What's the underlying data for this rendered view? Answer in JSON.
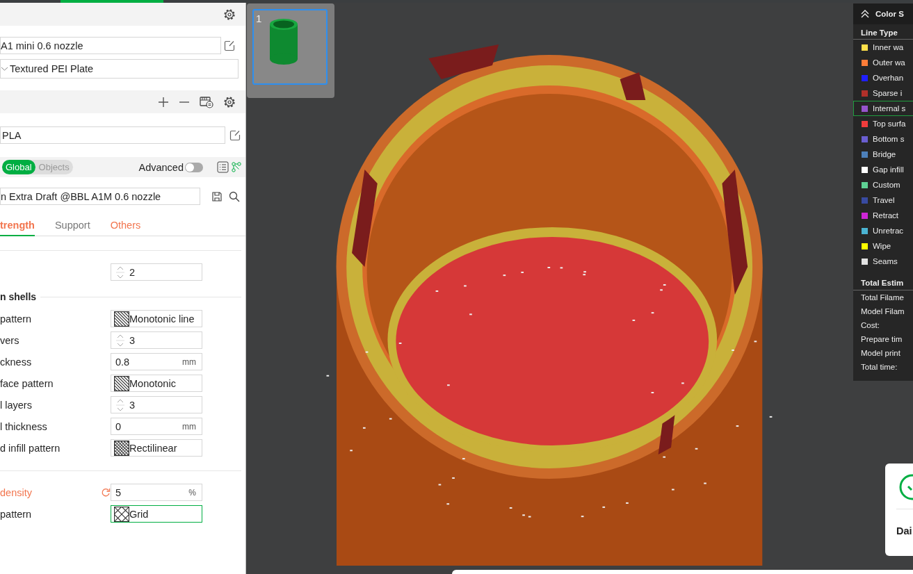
{
  "printer": {
    "preset": "A1 mini 0.6 nozzle",
    "plate": "Textured PEI Plate"
  },
  "filament": {
    "preset": "PLA"
  },
  "scope": {
    "segments": [
      {
        "label": "Global",
        "selected": true
      },
      {
        "label": "Objects",
        "selected": false
      }
    ],
    "advanced_label": "Advanced",
    "advanced_on": false
  },
  "process": {
    "preset": "n Extra Draft @BBL A1M 0.6 nozzle"
  },
  "tabs": [
    {
      "label": "trength",
      "selected": true,
      "modified": true
    },
    {
      "label": "Support",
      "selected": false,
      "modified": false
    },
    {
      "label": "Others",
      "selected": false,
      "modified": true
    }
  ],
  "sections": [
    {
      "rows": [
        {
          "kind": "spin",
          "value": "2",
          "modified": false,
          "focused": false
        }
      ]
    },
    {
      "heading": "n shells",
      "rows": [
        {
          "label": "pattern",
          "kind": "hatch",
          "value": "Monotonic line",
          "modified": false,
          "focused": false
        },
        {
          "label": "vers",
          "kind": "spin",
          "value": "3",
          "modified": false,
          "focused": false
        },
        {
          "label": "ckness",
          "kind": "measure",
          "value": "0.8",
          "unit": "mm",
          "modified": false,
          "focused": false
        },
        {
          "label": "face pattern",
          "kind": "hatch",
          "value": "Monotonic",
          "modified": false,
          "focused": false
        },
        {
          "label": "l layers",
          "kind": "spin",
          "value": "3",
          "modified": false,
          "focused": false
        },
        {
          "label": "l thickness",
          "kind": "measure",
          "value": "0",
          "unit": "mm",
          "modified": false,
          "focused": false
        },
        {
          "label": "d infill pattern",
          "kind": "crosshatch",
          "value": "Rectilinear",
          "modified": false,
          "focused": false
        }
      ]
    },
    {
      "rows": [
        {
          "label": "density",
          "kind": "measure",
          "value": "5",
          "unit": "%",
          "modified": true,
          "focused": false
        },
        {
          "label": "pattern",
          "kind": "grid",
          "value": "Grid",
          "modified": false,
          "focused": true
        }
      ]
    }
  ],
  "thumbnail": {
    "label": "1",
    "selected": true
  },
  "legend": {
    "title": "Color S",
    "section": "Line Type",
    "items": [
      {
        "label": "Inner wa",
        "color": "#ffe04a",
        "selected": false
      },
      {
        "label": "Outer wa",
        "color": "#ff7d38",
        "selected": false
      },
      {
        "label": "Overhan",
        "color": "#1f1fff",
        "selected": false
      },
      {
        "label": "Sparse i",
        "color": "#b1302a",
        "selected": false
      },
      {
        "label": "Internal s",
        "color": "#9654cc",
        "selected": true
      },
      {
        "label": "Top surfa",
        "color": "#f03c3c",
        "selected": false
      },
      {
        "label": "Bottom s",
        "color": "#6a5ed0",
        "selected": false
      },
      {
        "label": "Bridge",
        "color": "#4d80ba",
        "selected": false
      },
      {
        "label": "Gap infill",
        "color": "#ffffff",
        "selected": false
      },
      {
        "label": "Custom",
        "color": "#5ed194",
        "selected": false
      },
      {
        "label": "Travel",
        "color": "#384aa0",
        "selected": false
      },
      {
        "label": "Retract",
        "color": "#cd26d6",
        "selected": false
      },
      {
        "label": "Unretrac",
        "color": "#4bb4d2",
        "selected": false
      },
      {
        "label": "Wipe",
        "color": "#ffff00",
        "selected": false
      },
      {
        "label": "Seams",
        "color": "#e2e2e2",
        "selected": false
      }
    ],
    "estimate_title": "Total Estim",
    "estimate_rows": [
      "Total Filame",
      "Model Filam",
      "Cost:",
      "Prepare tim",
      "Model print",
      "Total time:"
    ]
  },
  "notice": {
    "title": "Dai"
  }
}
